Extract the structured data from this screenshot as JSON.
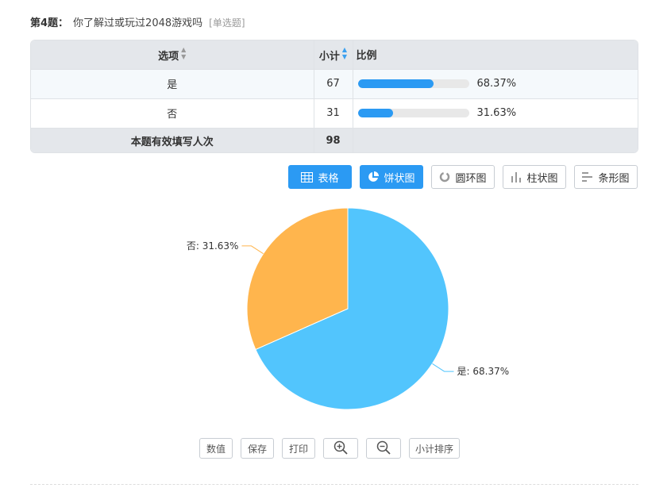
{
  "question": {
    "number_label": "第4题：",
    "text": "你了解过或玩过2048游戏吗",
    "type_label": "[单选题]"
  },
  "table": {
    "headers": {
      "option": "选项",
      "count": "小计",
      "ratio": "比例"
    },
    "rows": [
      {
        "option": "是",
        "count": "67",
        "percent": "68.37%",
        "fraction": 0.6837
      },
      {
        "option": "否",
        "count": "31",
        "percent": "31.63%",
        "fraction": 0.3163
      }
    ],
    "total_label": "本题有效填写人次",
    "total_value": "98"
  },
  "view_buttons": [
    {
      "label": "表格",
      "icon": "table-icon",
      "active": true
    },
    {
      "label": "饼状图",
      "icon": "pie-icon",
      "active": true
    },
    {
      "label": "圆环图",
      "icon": "ring-icon",
      "active": false
    },
    {
      "label": "柱状图",
      "icon": "column-chart-icon",
      "active": false
    },
    {
      "label": "条形图",
      "icon": "bar-chart-icon",
      "active": false
    }
  ],
  "tools": {
    "value": "数值",
    "save": "保存",
    "print": "打印",
    "zoom_in_icon": "zoom-in-icon",
    "zoom_out_icon": "zoom-out-icon",
    "sort": "小计排序"
  },
  "colors": {
    "accent": "#2b9af3",
    "slice_yes": "#52c5fd",
    "slice_no": "#ffb54d"
  },
  "chart_data": {
    "type": "pie",
    "title": "",
    "slices": [
      {
        "label": "是",
        "value": 67,
        "percent": "68.37%",
        "color": "#52c5fd",
        "data_label": "是: 68.37%"
      },
      {
        "label": "否",
        "value": 31,
        "percent": "31.63%",
        "color": "#ffb54d",
        "data_label": "否: 31.63%"
      }
    ],
    "legend": "none"
  }
}
